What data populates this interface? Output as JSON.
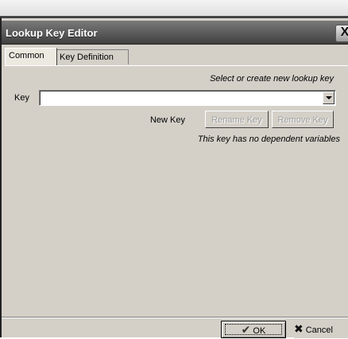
{
  "window": {
    "title": "Lookup Key Editor",
    "close_glyph": "X"
  },
  "tabs": [
    {
      "label": "Common",
      "active": true
    },
    {
      "label": "Key Definition",
      "active": false
    }
  ],
  "common": {
    "hint": "Select or create new lookup key",
    "key_label": "Key",
    "key_value": "",
    "buttons": {
      "new_key": "New Key",
      "rename_key": "Rename Key",
      "remove_key": "Remove Key"
    },
    "dependency_status": "This key has no dependent variables"
  },
  "footer": {
    "ok_label": "OK",
    "ok_icon": "check-icon",
    "cancel_label": "Cancel",
    "cancel_icon": "x-icon"
  }
}
